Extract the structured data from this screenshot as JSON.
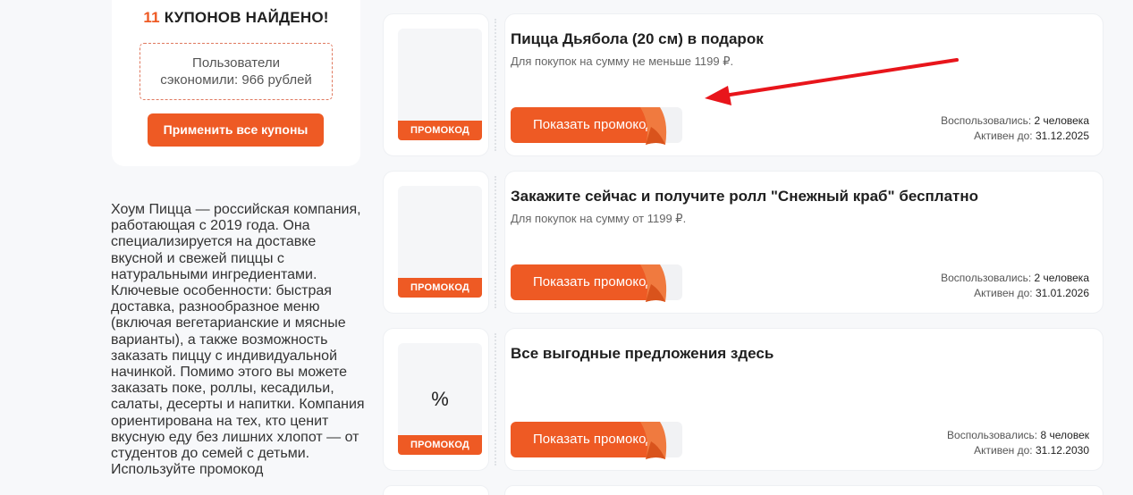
{
  "sidebar": {
    "found_count": "11",
    "found_text": "КУПОНОВ НАЙДЕНО!",
    "saved_line1": "Пользователи",
    "saved_line2": "сэкономили: 966 рублей",
    "apply_all_label": "Применить все купоны",
    "about": "Хоум Пицца — российская компания, работающая с 2019 года. Она специализируется на доставке вкусной и свежей пиццы с натуральными ингредиентами. Ключевые особенности: быстрая доставка, разнообразное меню (включая вегетарианские и мясные варианты), а также возможность заказать пиццу с индивидуальной начинкой. Помимо этого вы можете заказать поке, роллы, кесадильи, салаты, десерты и напитки. Компания ориентирована на тех, кто ценит вкусную еду без лишних хлопот — от студентов до семей с детьми. Используйте промокод"
  },
  "coupons": [
    {
      "title": "Пицца Дьябола (20 см) в подарок",
      "subtitle": "Для покупок на сумму не меньше 1199 ₽.",
      "badge": "ПРОМОКОД",
      "image_text": "",
      "button_label": "Показать промокод",
      "used_label": "Воспользовались:",
      "used_value": "2 человека",
      "active_label": "Активен до:",
      "active_value": "31.12.2025"
    },
    {
      "title": "Закажите сейчас и получите ролл \"Снежный краб\" бесплатно",
      "subtitle": "Для покупок на сумму от 1199 ₽.",
      "badge": "ПРОМОКОД",
      "image_text": "",
      "button_label": "Показать промокод",
      "used_label": "Воспользовались:",
      "used_value": "2 человека",
      "active_label": "Активен до:",
      "active_value": "31.01.2026"
    },
    {
      "title": "Все выгодные предложения здесь",
      "subtitle": "",
      "badge": "ПРОМОКОД",
      "image_text": "%",
      "button_label": "Показать промокод",
      "used_label": "Воспользовались:",
      "used_value": "8 человек",
      "active_label": "Активен до:",
      "active_value": "31.12.2030"
    }
  ],
  "colors": {
    "accent": "#ee5a24",
    "annotation_arrow": "#e8151b"
  }
}
